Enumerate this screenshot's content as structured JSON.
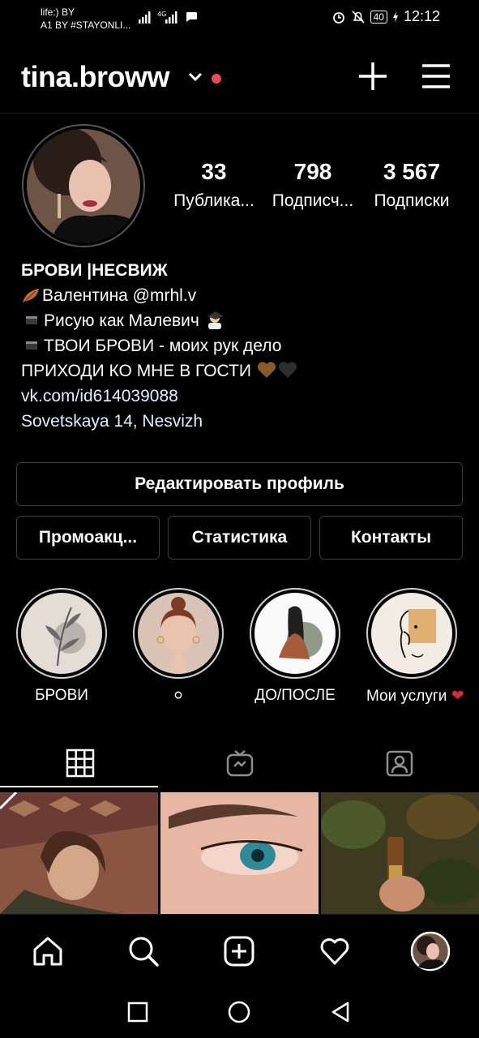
{
  "status_bar": {
    "carrier_line1": "life:) BY",
    "carrier_line2": "A1 BY #STAYONLI...",
    "battery": "40",
    "time": "12:12"
  },
  "header": {
    "username": "tina.broww"
  },
  "profile": {
    "stats": [
      {
        "value": "33",
        "label": "Публика..."
      },
      {
        "value": "798",
        "label": "Подписч..."
      },
      {
        "value": "3 567",
        "label": "Подписки"
      }
    ]
  },
  "bio": {
    "name": "БРОВИ |НЕСВИЖ",
    "line1": "Валентина @mrhl.v",
    "line2": "Рисую как Малевич",
    "line3": "ТВОИ БРОВИ - моих рук дело",
    "line4": "ПРИХОДИ КО МНЕ В ГОСТИ",
    "link": "vk.com/id614039088",
    "address": "Sovetskaya 14, Nesvizh"
  },
  "buttons": {
    "edit_profile": "Редактировать профиль",
    "promotions": "Промоакц...",
    "insights": "Статистика",
    "contacts": "Контакты"
  },
  "highlights": [
    {
      "label": "БРОВИ"
    },
    {
      "label": "⚪"
    },
    {
      "label": "ДО/ПОСЛЕ"
    },
    {
      "label": "Мои услуги"
    }
  ],
  "colors": {
    "background": "#000000",
    "accent_red": "#ed4956",
    "link": "#e0f1ff",
    "button_border": "#3c3c3c"
  },
  "icons": [
    "chevron-down-icon",
    "plus-icon",
    "hamburger-menu-icon",
    "grid-icon",
    "igtv-icon",
    "tagged-icon",
    "home-icon",
    "search-icon",
    "new-post-icon",
    "heart-icon",
    "profile-avatar-icon"
  ]
}
